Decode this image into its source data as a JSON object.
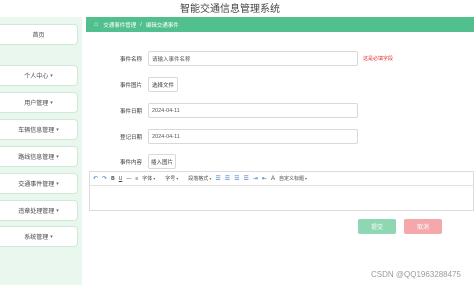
{
  "app": {
    "title": "智能交通信息管理系统"
  },
  "sidebar": {
    "items": [
      {
        "label": "首页",
        "has_caret": false
      },
      {
        "label": "个人中心",
        "has_caret": true
      },
      {
        "label": "用户管理",
        "has_caret": true
      },
      {
        "label": "车辆信息管理",
        "has_caret": true
      },
      {
        "label": "路线信息管理",
        "has_caret": true
      },
      {
        "label": "交通事件管理",
        "has_caret": true
      },
      {
        "label": "违章处理管理",
        "has_caret": true
      },
      {
        "label": "系统管理",
        "has_caret": true
      }
    ]
  },
  "breadcrumb": {
    "items": [
      "交通事件管理",
      "编辑交通事件"
    ]
  },
  "form": {
    "event_name_label": "事件名称",
    "event_name_placeholder": "请输入事件名称",
    "event_name_hint": "这是必填字段",
    "event_image_label": "事件图片",
    "choose_file_label": "选择文件",
    "event_date_label": "事件日期",
    "event_date_value": "2024-04-11",
    "register_date_label": "登记日期",
    "register_date_value": "2024-04-11",
    "event_content_label": "事件内容",
    "insert_image_label": "插入图片"
  },
  "editor": {
    "font_family": "字体",
    "font_size": "字号",
    "paragraph": "段落格式",
    "custom_title": "自定义标题"
  },
  "actions": {
    "submit": "提交",
    "cancel": "取消"
  },
  "watermark": "CSDN @QQ1963288475",
  "colors": {
    "accent": "#52bf8f",
    "sidebar_bg": "#e9f7ee",
    "submit": "#8fd6b2",
    "cancel": "#f4a8ab",
    "hint": "#e03030"
  }
}
